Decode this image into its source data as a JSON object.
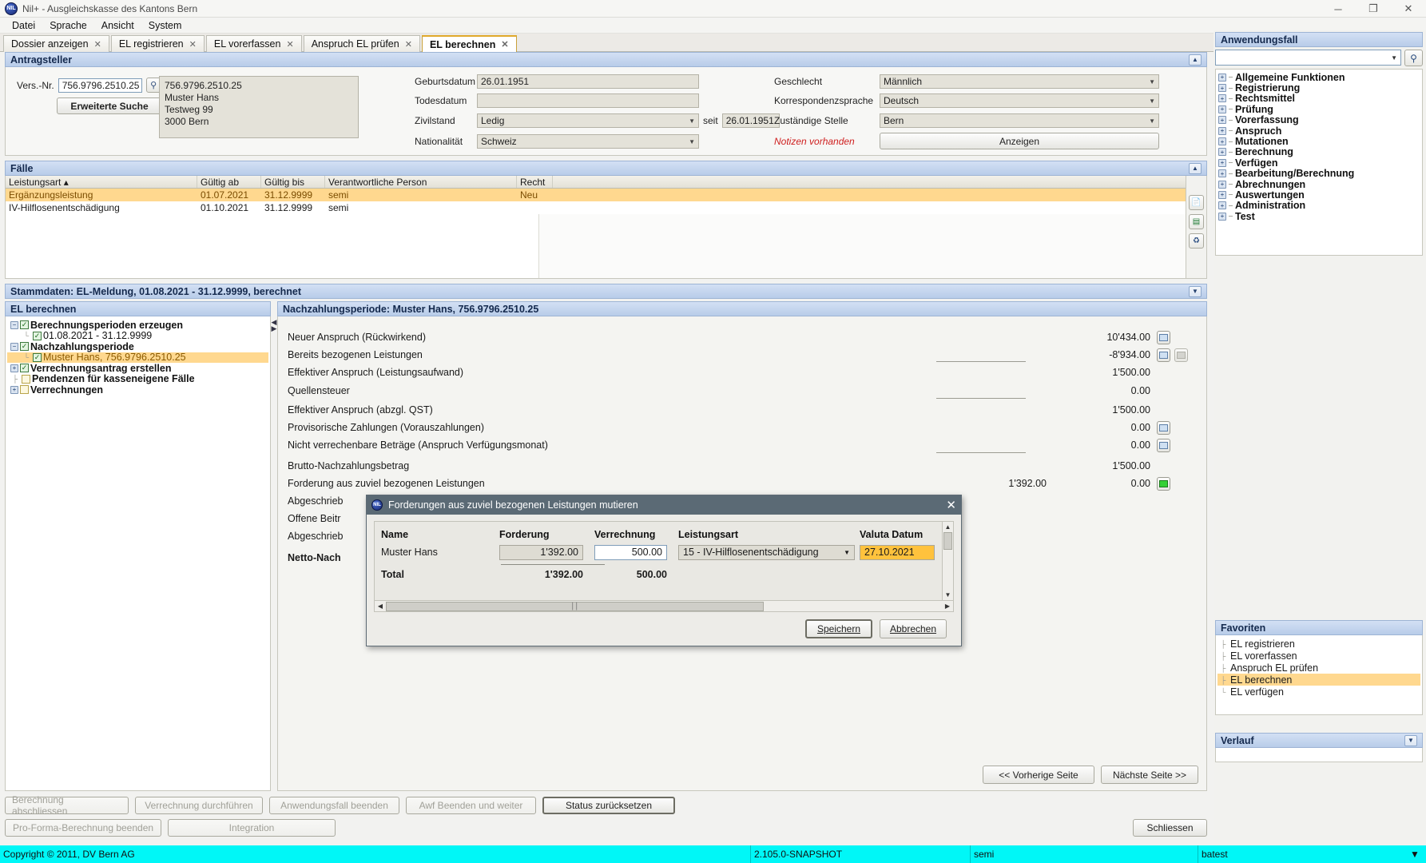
{
  "window": {
    "title": "Nil+ - Ausgleichskasse des Kantons Bern",
    "icon": "nil-logo-icon",
    "minimize": "─",
    "maximize": "❐",
    "close": "✕"
  },
  "menubar": {
    "items": [
      "Datei",
      "Sprache",
      "Ansicht",
      "System"
    ]
  },
  "tabs": [
    {
      "label": "Dossier anzeigen",
      "active": false
    },
    {
      "label": "EL registrieren",
      "active": false
    },
    {
      "label": "EL vorerfassen",
      "active": false
    },
    {
      "label": "Anspruch EL prüfen",
      "active": false
    },
    {
      "label": "EL berechnen",
      "active": true
    }
  ],
  "tab_close_glyph": "✕",
  "antragsteller": {
    "header": "Antragsteller",
    "collapse_glyph": "▲",
    "vers_nr_label": "Vers.-Nr.",
    "vers_nr_value": "756.9796.2510.25",
    "search_icon": "magnifier-icon",
    "erweiterte_suche": "Erweiterte Suche",
    "address": "756.9796.2510.25\nMuster Hans\nTestweg 99\n3000 Bern",
    "fields": [
      {
        "label": "Geburtsdatum",
        "value": "26.01.1951"
      },
      {
        "label": "Todesdatum",
        "value": ""
      },
      {
        "label": "Zivilstand",
        "value": "Ledig"
      },
      {
        "label": "Nationalität",
        "value": "Schweiz"
      }
    ],
    "seit_label": "seit",
    "seit_value": "26.01.1951",
    "right_fields": [
      {
        "label": "Geschlecht",
        "value": "Männlich"
      },
      {
        "label": "Korrespondenzsprache",
        "value": "Deutsch"
      },
      {
        "label": "Zuständige Stelle",
        "value": "Bern"
      }
    ],
    "notizen": "Notizen vorhanden",
    "anzeigen": "Anzeigen"
  },
  "faelle": {
    "header": "Fälle",
    "collapse_glyph": "▲",
    "columns": [
      "Leistungsart ▴",
      "Gültig ab",
      "Gültig bis",
      "Verantwortliche Person",
      "Recht"
    ],
    "rows": [
      {
        "cells": [
          "Ergänzungsleistung",
          "01.07.2021",
          "31.12.9999",
          "semi",
          "Neu"
        ],
        "selected": true
      },
      {
        "cells": [
          "IV-Hilflosenentschädigung",
          "01.10.2021",
          "31.12.9999",
          "semi",
          ""
        ],
        "selected": false
      }
    ],
    "side_icons": [
      "print-icon",
      "excel-icon",
      "history-icon"
    ]
  },
  "stammdaten": {
    "header": "Stammdaten: EL-Meldung, 01.08.2021 - 31.12.9999, berechnet",
    "collapse_glyph": "▼"
  },
  "tree_panel": {
    "header": "EL berechnen",
    "nodes": [
      {
        "label": "Berechnungsperioden erzeugen",
        "level": 0,
        "expander": "−",
        "checked": true,
        "bold": true,
        "selected": false
      },
      {
        "label": "01.08.2021 - 31.12.9999",
        "level": 1,
        "expander": "",
        "checked": true,
        "bold": false,
        "selected": false
      },
      {
        "label": "Nachzahlungsperiode",
        "level": 0,
        "expander": "−",
        "checked": true,
        "bold": true,
        "selected": false
      },
      {
        "label": "Muster Hans, 756.9796.2510.25",
        "level": 1,
        "expander": "",
        "checked": true,
        "bold": false,
        "selected": true
      },
      {
        "label": "Verrechnungsantrag erstellen",
        "level": 0,
        "expander": "+",
        "checked": true,
        "bold": true,
        "selected": false
      },
      {
        "label": "Pendenzen für kasseneigene Fälle",
        "level": 0,
        "expander": "",
        "checked": false,
        "bold": true,
        "selected": false
      },
      {
        "label": "Verrechnungen",
        "level": 0,
        "expander": "+",
        "checked": false,
        "bold": true,
        "selected": false
      }
    ]
  },
  "detail": {
    "header": "Nachzahlungsperiode: Muster Hans, 756.9796.2510.25",
    "rows": [
      {
        "label": "Neuer Anspruch (Rückwirkend)",
        "value": "10'434.00",
        "icon": "list-icon",
        "icon2": ""
      },
      {
        "label": "Bereits bezogenen Leistungen",
        "value": "-8'934.00",
        "icon": "list-icon",
        "icon2": "blank-icon"
      },
      {
        "label": "Effektiver Anspruch (Leistungsaufwand)",
        "value": "1'500.00",
        "icon": "",
        "icon2": ""
      },
      {
        "label": "Quellensteuer",
        "value": "0.00",
        "icon": "",
        "icon2": ""
      },
      {
        "label": "Effektiver Anspruch (abzgl. QST)",
        "value": "1'500.00",
        "icon": "",
        "icon2": ""
      },
      {
        "label": "Provisorische Zahlungen (Vorauszahlungen)",
        "value": "0.00",
        "icon": "list-icon",
        "icon2": ""
      },
      {
        "label": "Nicht verrechenbare Beträge (Anspruch Verfügungsmonat)",
        "value": "0.00",
        "icon": "list-icon",
        "icon2": ""
      },
      {
        "label": "Brutto-Nachzahlungsbetrag",
        "value": "1'500.00",
        "icon": "",
        "icon2": ""
      },
      {
        "label": "Forderung aus zuviel bezogenen Leistungen",
        "value": "0.00",
        "value2": "1'392.00",
        "icon": "list-green-icon",
        "icon2": ""
      },
      {
        "label": "Abgeschrieb",
        "value": "",
        "icon": "",
        "icon2": ""
      },
      {
        "label": "Offene Beitr",
        "value": "",
        "icon": "",
        "icon2": ""
      },
      {
        "label": "Abgeschrieb",
        "value": "",
        "icon": "",
        "icon2": ""
      },
      {
        "label": "Netto-Nach",
        "value": "",
        "icon": "",
        "icon2": ""
      }
    ],
    "prev_page": "<< Vorherige Seite",
    "next_page": "Nächste Seite >>"
  },
  "actions": {
    "row1": [
      {
        "label": "Berechnung abschliessen",
        "disabled": true
      },
      {
        "label": "Verrechnung durchführen",
        "disabled": true
      },
      {
        "label": "Anwendungsfall beenden",
        "disabled": true
      },
      {
        "label": "Awf Beenden und weiter",
        "disabled": true
      },
      {
        "label": "Status zurücksetzen",
        "disabled": false
      }
    ],
    "row2": [
      {
        "label": "Pro-Forma-Berechnung beenden",
        "disabled": true
      },
      {
        "label": "Integration",
        "disabled": true
      }
    ],
    "schliessen": "Schliessen"
  },
  "sidebar": {
    "anwendungsfall": {
      "header": "Anwendungsfall",
      "search_value": "",
      "search_icon": "magnifier-icon",
      "caret": "▼",
      "items": [
        "Allgemeine Funktionen",
        "Registrierung",
        "Rechtsmittel",
        "Prüfung",
        "Vorerfassung",
        "Anspruch",
        "Mutationen",
        "Berechnung",
        "Verfügen",
        "Bearbeitung/Berechnung",
        "Abrechnungen",
        "Auswertungen",
        "Administration",
        "Test"
      ],
      "expander": "+"
    },
    "favoriten": {
      "header": "Favoriten",
      "items": [
        {
          "label": "EL registrieren",
          "selected": false
        },
        {
          "label": "EL vorerfassen",
          "selected": false
        },
        {
          "label": "Anspruch EL prüfen",
          "selected": false
        },
        {
          "label": "EL berechnen",
          "selected": true
        },
        {
          "label": "EL verfügen",
          "selected": false
        }
      ]
    },
    "verlauf": {
      "header": "Verlauf",
      "collapse_glyph": "▼"
    }
  },
  "modal": {
    "title": "Forderungen aus zuviel bezogenen Leistungen mutieren",
    "icon": "nil-logo-icon",
    "close_glyph": "✕",
    "columns": [
      "Name",
      "Forderung",
      "Verrechnung",
      "Leistungsart",
      "Valuta Datum"
    ],
    "rows": [
      {
        "name": "Muster Hans",
        "forderung": "1'392.00",
        "verrechnung": "500.00",
        "leistungsart": "15 - IV-Hilflosenentschädigung",
        "valuta": "27.10.2021"
      }
    ],
    "total_label": "Total",
    "total_forderung": "1'392.00",
    "total_verrechnung": "500.00",
    "save": "Speichern",
    "cancel": "Abbrechen",
    "caret": "▼"
  },
  "statusbar": {
    "copyright": "Copyright © 2011, DV Bern AG",
    "version": "2.105.0-SNAPSHOT",
    "user": "semi",
    "env": "batest",
    "expand_glyph": "▼"
  },
  "colors": {
    "selection": "#ffd88f",
    "panel_header_start": "#d3e0f4",
    "panel_header_end": "#b8cce9",
    "status_bar": "#00f7f7",
    "modal_title": "#5b6a75",
    "notice_red": "#cf2020",
    "valuta_highlight": "#ffc23d"
  }
}
